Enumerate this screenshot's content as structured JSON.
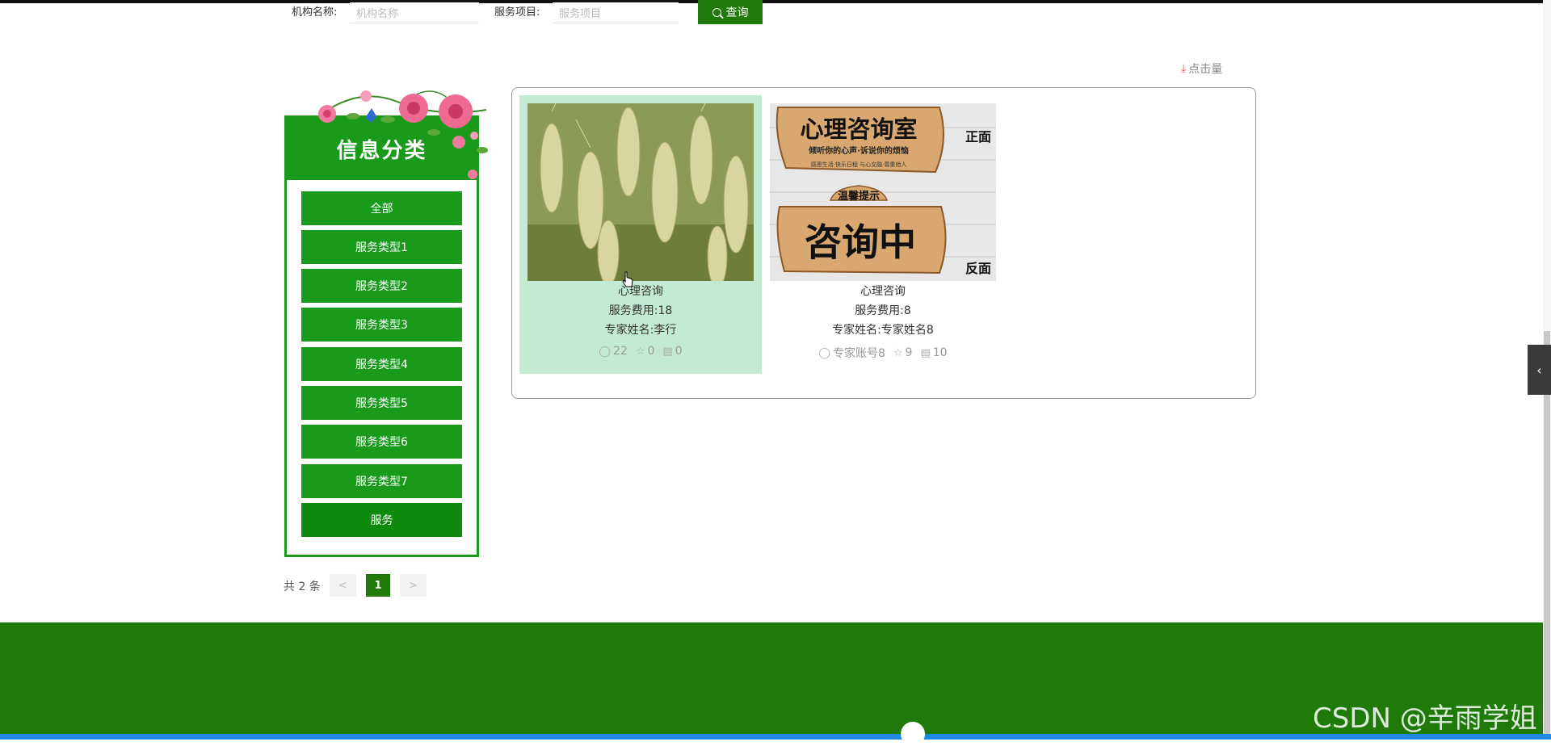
{
  "search": {
    "org_label": "机构名称:",
    "org_placeholder": "机构名称",
    "service_label": "服务项目:",
    "service_placeholder": "服务项目",
    "button_label": "查询",
    "button_icon": "search-icon"
  },
  "sort": {
    "label": "点击量",
    "icon": "download-icon"
  },
  "sidebar": {
    "title": "信息分类",
    "items": [
      {
        "label": "全部"
      },
      {
        "label": "服务类型1"
      },
      {
        "label": "服务类型2"
      },
      {
        "label": "服务类型3"
      },
      {
        "label": "服务类型4"
      },
      {
        "label": "服务类型5"
      },
      {
        "label": "服务类型6"
      },
      {
        "label": "服务类型7"
      },
      {
        "label": "服务"
      }
    ]
  },
  "cards": [
    {
      "title": "心理咨询",
      "fee": "服务费用:18",
      "expert": "专家姓名:李行",
      "views": "22",
      "stars": "0",
      "comments": "0",
      "image": "wheat-photo"
    },
    {
      "title": "心理咨询",
      "fee": "服务费用:8",
      "expert": "专家姓名:专家姓名8",
      "account": "专家账号8",
      "stars": "9",
      "comments": "10",
      "image": "consult-room-sign",
      "sign_title": "心理咨询室",
      "sign_sub": "倾听你的心声·诉说你的烦恼",
      "sign_small": "感恩生活·快乐日程 与心交融·尊重他人",
      "sign_tip": "温馨提示",
      "sign_status": "咨询中",
      "side_front": "正面",
      "side_back": "反面"
    }
  ],
  "pagination": {
    "total": "共 2 条",
    "prev": "<",
    "current": "1",
    "next": ">"
  },
  "watermark": "CSDN @辛雨学姐",
  "colors": {
    "primary_green": "#1a9a1a",
    "dark_green": "#1f7a0a",
    "hover_bg": "#c3ead3",
    "footer_bar": "#1e88e5"
  }
}
